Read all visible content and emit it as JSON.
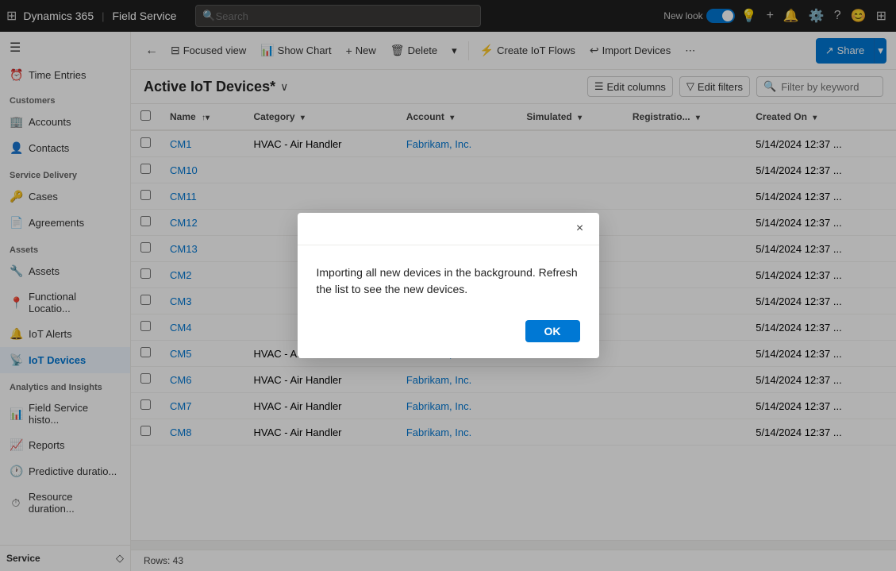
{
  "topNav": {
    "gridIcon": "⊞",
    "dynamics": "Dynamics 365",
    "separator": "|",
    "app": "Field Service",
    "searchPlaceholder": "Search",
    "newLookLabel": "New look",
    "shareLabel": "Share"
  },
  "sidebar": {
    "hamburgerIcon": "☰",
    "timeEntries": "Time Entries",
    "sections": [
      {
        "label": "Customers",
        "items": [
          {
            "id": "accounts",
            "icon": "🏢",
            "label": "Accounts"
          },
          {
            "id": "contacts",
            "icon": "👤",
            "label": "Contacts"
          }
        ]
      },
      {
        "label": "Service Delivery",
        "items": [
          {
            "id": "cases",
            "icon": "🔑",
            "label": "Cases"
          },
          {
            "id": "agreements",
            "icon": "📄",
            "label": "Agreements"
          }
        ]
      },
      {
        "label": "Assets",
        "items": [
          {
            "id": "assets",
            "icon": "🔧",
            "label": "Assets"
          },
          {
            "id": "functional-location",
            "icon": "📍",
            "label": "Functional Locatio..."
          },
          {
            "id": "iot-alerts",
            "icon": "🔔",
            "label": "IoT Alerts"
          },
          {
            "id": "iot-devices",
            "icon": "📡",
            "label": "IoT Devices",
            "active": true
          }
        ]
      },
      {
        "label": "Analytics and Insights",
        "items": [
          {
            "id": "field-service-histo",
            "icon": "📊",
            "label": "Field Service histo..."
          },
          {
            "id": "reports",
            "icon": "📈",
            "label": "Reports"
          },
          {
            "id": "predictive-duratio",
            "icon": "🕐",
            "label": "Predictive duratio..."
          },
          {
            "id": "resource-duratio",
            "icon": "⏱",
            "label": "Resource duration..."
          }
        ]
      }
    ],
    "bottomLabel": "Service",
    "bottomIcon": "◇"
  },
  "toolbar": {
    "backIcon": "←",
    "focusedViewIcon": "⊟",
    "focusedViewLabel": "Focused view",
    "showChartIcon": "📊",
    "showChartLabel": "Show Chart",
    "newIcon": "+",
    "newLabel": "New",
    "deleteIcon": "🗑",
    "deleteLabel": "Delete",
    "dropdownIcon": "▾",
    "createIoTFlowsIcon": "⚡",
    "createIoTFlowsLabel": "Create IoT Flows",
    "importDevicesIcon": "↩",
    "importDevicesLabel": "Import Devices",
    "moreIcon": "⋯",
    "shareIcon": "↗",
    "shareLabel": "Share"
  },
  "listView": {
    "title": "Active IoT Devices*",
    "dropdownIcon": "∨",
    "editColumnsIcon": "☰",
    "editColumnsLabel": "Edit columns",
    "editFiltersIcon": "▽",
    "editFiltersLabel": "Edit filters",
    "filterPlaceholder": "Filter by keyword",
    "columns": [
      {
        "id": "name",
        "label": "Name",
        "sortIcon": "↑▾"
      },
      {
        "id": "category",
        "label": "Category",
        "sortIcon": "▾"
      },
      {
        "id": "account",
        "label": "Account",
        "sortIcon": "▾"
      },
      {
        "id": "simulated",
        "label": "Simulated",
        "sortIcon": "▾"
      },
      {
        "id": "registration",
        "label": "Registratio...",
        "sortIcon": "▾"
      },
      {
        "id": "created-on",
        "label": "Created On",
        "sortIcon": "▾"
      }
    ],
    "rows": [
      {
        "name": "CM1",
        "category": "HVAC - Air Handler",
        "account": "Fabrikam, Inc.",
        "simulated": "",
        "registration": "",
        "createdOn": "5/14/2024 12:37 ..."
      },
      {
        "name": "CM10",
        "category": "",
        "account": "",
        "simulated": "",
        "registration": "",
        "createdOn": "5/14/2024 12:37 ..."
      },
      {
        "name": "CM11",
        "category": "",
        "account": "",
        "simulated": "",
        "registration": "",
        "createdOn": "5/14/2024 12:37 ..."
      },
      {
        "name": "CM12",
        "category": "",
        "account": "",
        "simulated": "",
        "registration": "",
        "createdOn": "5/14/2024 12:37 ..."
      },
      {
        "name": "CM13",
        "category": "",
        "account": "",
        "simulated": "",
        "registration": "",
        "createdOn": "5/14/2024 12:37 ..."
      },
      {
        "name": "CM2",
        "category": "",
        "account": "",
        "simulated": "",
        "registration": "",
        "createdOn": "5/14/2024 12:37 ..."
      },
      {
        "name": "CM3",
        "category": "",
        "account": "",
        "simulated": "",
        "registration": "",
        "createdOn": "5/14/2024 12:37 ..."
      },
      {
        "name": "CM4",
        "category": "",
        "account": "",
        "simulated": "",
        "registration": "",
        "createdOn": "5/14/2024 12:37 ..."
      },
      {
        "name": "CM5",
        "category": "HVAC - Air Handler",
        "account": "Fabrikam, Inc.",
        "simulated": "",
        "registration": "",
        "createdOn": "5/14/2024 12:37 ..."
      },
      {
        "name": "CM6",
        "category": "HVAC - Air Handler",
        "account": "Fabrikam, Inc.",
        "simulated": "",
        "registration": "",
        "createdOn": "5/14/2024 12:37 ..."
      },
      {
        "name": "CM7",
        "category": "HVAC - Air Handler",
        "account": "Fabrikam, Inc.",
        "simulated": "",
        "registration": "",
        "createdOn": "5/14/2024 12:37 ..."
      },
      {
        "name": "CM8",
        "category": "HVAC - Air Handler",
        "account": "Fabrikam, Inc.",
        "simulated": "",
        "registration": "",
        "createdOn": "5/14/2024 12:37 ..."
      }
    ],
    "rowsCount": "Rows: 43"
  },
  "dialog": {
    "message": "Importing all new devices in the background. Refresh the list to see the new devices.",
    "okLabel": "OK",
    "closeIcon": "×"
  }
}
